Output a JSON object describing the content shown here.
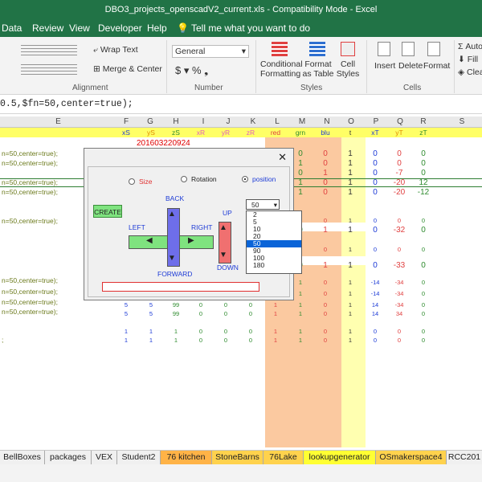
{
  "window": {
    "title": "DBO3_projects_openscadV2_current.xls  -  Compatibility Mode  -  Excel"
  },
  "menu": [
    "Data",
    "Review",
    "View",
    "Developer",
    "Help"
  ],
  "tell_me": "Tell me what you want to do",
  "ribbon": {
    "wrap_text": "Wrap Text",
    "merge_center": "Merge & Center",
    "alignment_label": "Alignment",
    "number_format": "General",
    "number_label": "Number",
    "conditional_formatting": "Conditional Formatting",
    "format_as_table": "Format as Table",
    "cell_styles": "Cell Styles",
    "styles_label": "Styles",
    "insert": "Insert",
    "delete": "Delete",
    "format": "Format",
    "cells_label": "Cells",
    "autosum": "Auto",
    "fill": "Fill",
    "clear": "Clea"
  },
  "formula": "0.5,$fn=50,center=true);",
  "columns": [
    "E",
    "F",
    "G",
    "H",
    "I",
    "J",
    "K",
    "L",
    "M",
    "N",
    "O",
    "P",
    "Q",
    "R",
    "S"
  ],
  "header_row": [
    "xS",
    "yS",
    "zS",
    "xR",
    "yR",
    "zR",
    "red",
    "grn",
    "blu",
    "t",
    "xT",
    "yT",
    "zT"
  ],
  "date_cell": "201603220924",
  "left_fragments": [
    "n=50,center=true);",
    "n=50,center=true);",
    "n=50,center=true);",
    "n=50,center=true);",
    "n=50,center=true);",
    "n=50,center=true);",
    "n=50,center=true);",
    "n=50,center=true);",
    "n=50,center=true);",
    ";"
  ],
  "grid_rows": [
    {
      "cols": [
        "",
        "",
        "",
        "",
        "",
        "",
        "",
        "0",
        "0",
        "1",
        "0",
        "0",
        "0"
      ]
    },
    {
      "cols": [
        "",
        "",
        "",
        "",
        "",
        "",
        "",
        "1",
        "0",
        "1",
        "0",
        "0",
        "0"
      ]
    },
    {
      "cols": [
        "",
        "",
        "",
        "",
        "",
        "",
        "",
        "0",
        "1",
        "1",
        "0",
        "-7",
        "0"
      ]
    },
    {
      "cols": [
        "",
        "",
        "",
        "",
        "",
        "",
        "",
        "1",
        "0",
        "1",
        "0",
        "-20",
        "12"
      ]
    },
    {
      "cols": [
        "",
        "",
        "",
        "",
        "",
        "",
        "",
        "1",
        "0",
        "1",
        "0",
        "-20",
        "-12"
      ]
    },
    {
      "cols": [
        "",
        "",
        "",
        "",
        "",
        "",
        "",
        "0",
        "0",
        "1",
        "0",
        "0",
        "0"
      ]
    },
    {
      "cols": [
        "",
        "",
        "",
        "",
        "",
        "",
        "",
        "0",
        "1",
        "1",
        "0",
        "-32",
        "0"
      ]
    },
    {
      "cols": [
        "",
        "",
        "",
        "",
        "",
        "",
        "",
        "0",
        "0",
        "1",
        "0",
        "0",
        "0"
      ]
    },
    {
      "cols": [
        "",
        "",
        "",
        "",
        "",
        "",
        "",
        "0",
        "1",
        "1",
        "0",
        "-33",
        "0"
      ]
    },
    {
      "cols": [
        "5",
        "5",
        "99",
        "0",
        "0",
        "0",
        "1",
        "1",
        "0",
        "1",
        "-14",
        "-34",
        "0"
      ]
    },
    {
      "cols": [
        "5",
        "5",
        "99",
        "0",
        "0",
        "0",
        "1",
        "1",
        "0",
        "1",
        "-14",
        "-34",
        "0"
      ]
    },
    {
      "cols": [
        "5",
        "5",
        "99",
        "0",
        "0",
        "0",
        "1",
        "1",
        "0",
        "1",
        "14",
        "-34",
        "0"
      ]
    },
    {
      "cols": [
        "5",
        "5",
        "99",
        "0",
        "0",
        "0",
        "1",
        "1",
        "0",
        "1",
        "14",
        "34",
        "0"
      ]
    },
    {
      "cols": [
        "1",
        "1",
        "1",
        "0",
        "0",
        "0",
        "1",
        "1",
        "0",
        "1",
        "0",
        "0",
        "0"
      ]
    },
    {
      "cols": [
        "1",
        "1",
        "1",
        "0",
        "0",
        "0",
        "1",
        "1",
        "0",
        "1",
        "0",
        "0",
        "0"
      ]
    }
  ],
  "dialog": {
    "close": "✕",
    "radio_size": "Size",
    "radio_rotation": "Rotation",
    "radio_position": "position",
    "create": "CREATE",
    "back": "BACK",
    "left": "LEFT",
    "right": "RIGHT",
    "forward": "FORWARD",
    "up": "UP",
    "down": "DOWN",
    "combo_value": "50",
    "list_items": [
      "2",
      "5",
      "10",
      "20",
      "50",
      "90",
      "100",
      "180"
    ],
    "list_selected": "50"
  },
  "sheet_tabs": [
    "BellBoxes",
    "packages",
    "VEX",
    "Student2",
    "76 kitchen",
    "StoneBarns",
    "76Lake",
    "lookupgenerator",
    "OSmakerspace4",
    "RCC201"
  ],
  "colors": {
    "excel_green": "#217346",
    "yellow": "#ffff66",
    "orange": "#fbc9a0",
    "pink": "#f6a7c8"
  }
}
